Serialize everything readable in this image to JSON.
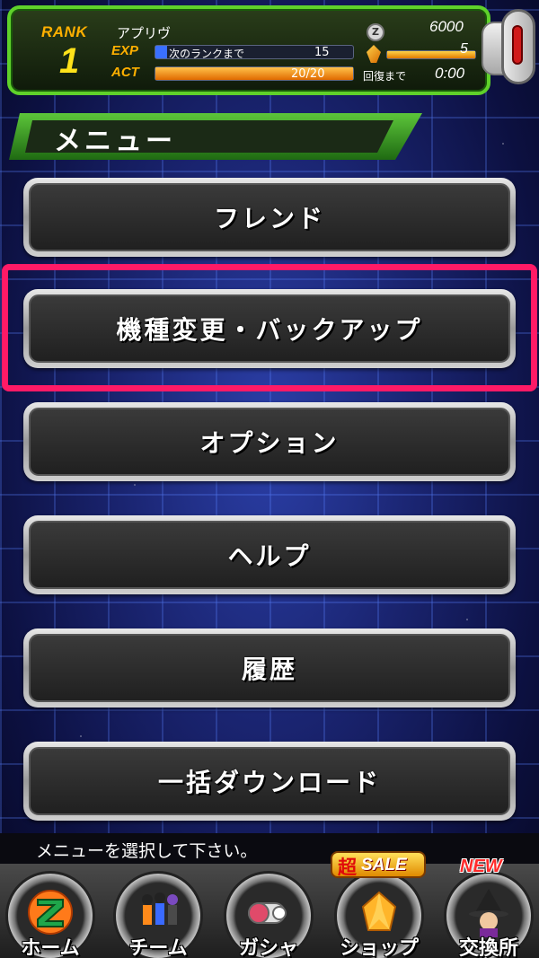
{
  "header": {
    "rank_label": "RANK",
    "rank_value": "1",
    "player_name": "アプリヴ",
    "exp_label": "EXP",
    "exp_text": "次のランクまで",
    "exp_value": "15",
    "act_label": "ACT",
    "act_value": "20/20",
    "zeni_value": "6000",
    "stones_value": "5",
    "recovery_label": "回復まで",
    "recovery_time": "0:00",
    "zeni_icon_glyph": "Z"
  },
  "menu": {
    "title": "メニュー",
    "items": [
      {
        "label": "フレンド"
      },
      {
        "label": "機種変更・バックアップ"
      },
      {
        "label": "オプション"
      },
      {
        "label": "ヘルプ"
      },
      {
        "label": "履歴"
      },
      {
        "label": "一括ダウンロード"
      }
    ],
    "highlight_color": "#ff1a66"
  },
  "footer": {
    "message": "メニューを選択して下さい。",
    "nav": [
      {
        "label": "ホーム",
        "icon": "dragon-ball-z-icon"
      },
      {
        "label": "チーム",
        "icon": "team-characters-icon"
      },
      {
        "label": "ガシャ",
        "icon": "capsule-icon"
      },
      {
        "label": "ショップ",
        "icon": "dragon-stone-icon",
        "badge_kanji": "超",
        "badge_text": "SALE"
      },
      {
        "label": "交換所",
        "icon": "baba-witch-icon",
        "badge_text": "NEW"
      }
    ]
  },
  "colors": {
    "accent_green": "#5fd12a",
    "rank_gold": "#ffb000",
    "highlight_pink": "#ff1a66"
  }
}
